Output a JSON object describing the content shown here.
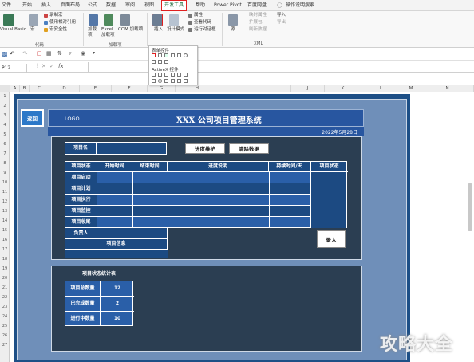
{
  "tabs": [
    "文件",
    "开始",
    "插入",
    "页面布局",
    "公式",
    "数据",
    "审阅",
    "视图",
    "开发工具",
    "帮助",
    "Power Pivot",
    "百度网盘",
    "操作说明搜索"
  ],
  "active_tab": "开发工具",
  "ribbon": {
    "code_group": {
      "vb_label": "Visual Basic",
      "macro_label": "宏",
      "record": "录制宏",
      "relative": "使用相对引用",
      "security": "宏安全性",
      "name": "代码"
    },
    "addins_group": {
      "addins": "加载项",
      "excel_addins": "Excel 加载项",
      "com_addins": "COM 加载项",
      "name": "加载项"
    },
    "controls_group": {
      "insert": "插入",
      "design_mode": "设计模式",
      "properties": "属性",
      "view_code": "查看代码",
      "run_dialog": "运行对话框",
      "name": "控件"
    },
    "xml_group": {
      "source": "源",
      "map_props": "映射属性",
      "expansion": "扩展包",
      "refresh": "刷新数据",
      "import": "导入",
      "export": "导出",
      "name": "XML"
    }
  },
  "popup": {
    "form_controls": "表单控件",
    "activex_controls": "ActiveX 控件"
  },
  "name_box": "P12",
  "columns": [
    "A",
    "B",
    "C",
    "D",
    "E",
    "F",
    "G",
    "H",
    "I",
    "J",
    "K",
    "L",
    "M",
    "N"
  ],
  "rows": [
    "1",
    "2",
    "3",
    "4",
    "5",
    "6",
    "7",
    "8",
    "9",
    "10",
    "11",
    "12",
    "13",
    "14",
    "15",
    "16",
    "17",
    "18",
    "19",
    "20",
    "21",
    "22",
    "23",
    "24",
    "25",
    "26",
    "27"
  ],
  "dashboard": {
    "back": "返回",
    "logo": "LOGO",
    "title": "XXX 公司项目管理系统",
    "date": "2022年5月28日",
    "project_name_label": "项目名",
    "btn_maintain": "进度维护",
    "btn_clear": "清除数据",
    "headers": [
      "项目状态",
      "开始时间",
      "结束时间",
      "进度说明",
      "持续时间/天",
      "项目状态"
    ],
    "stages": [
      "项目启动",
      "项目计划",
      "项目执行",
      "项目监控",
      "项目收尾"
    ],
    "owner": "负责人",
    "project_info": "项目信息",
    "btn_entry": "录入",
    "stats_title": "项目状态统计表",
    "stats": [
      {
        "label": "项目总数量",
        "value": "12"
      },
      {
        "label": "已完成数量",
        "value": "2"
      },
      {
        "label": "进行中数量",
        "value": "10"
      }
    ]
  },
  "watermark": "攻略大全"
}
